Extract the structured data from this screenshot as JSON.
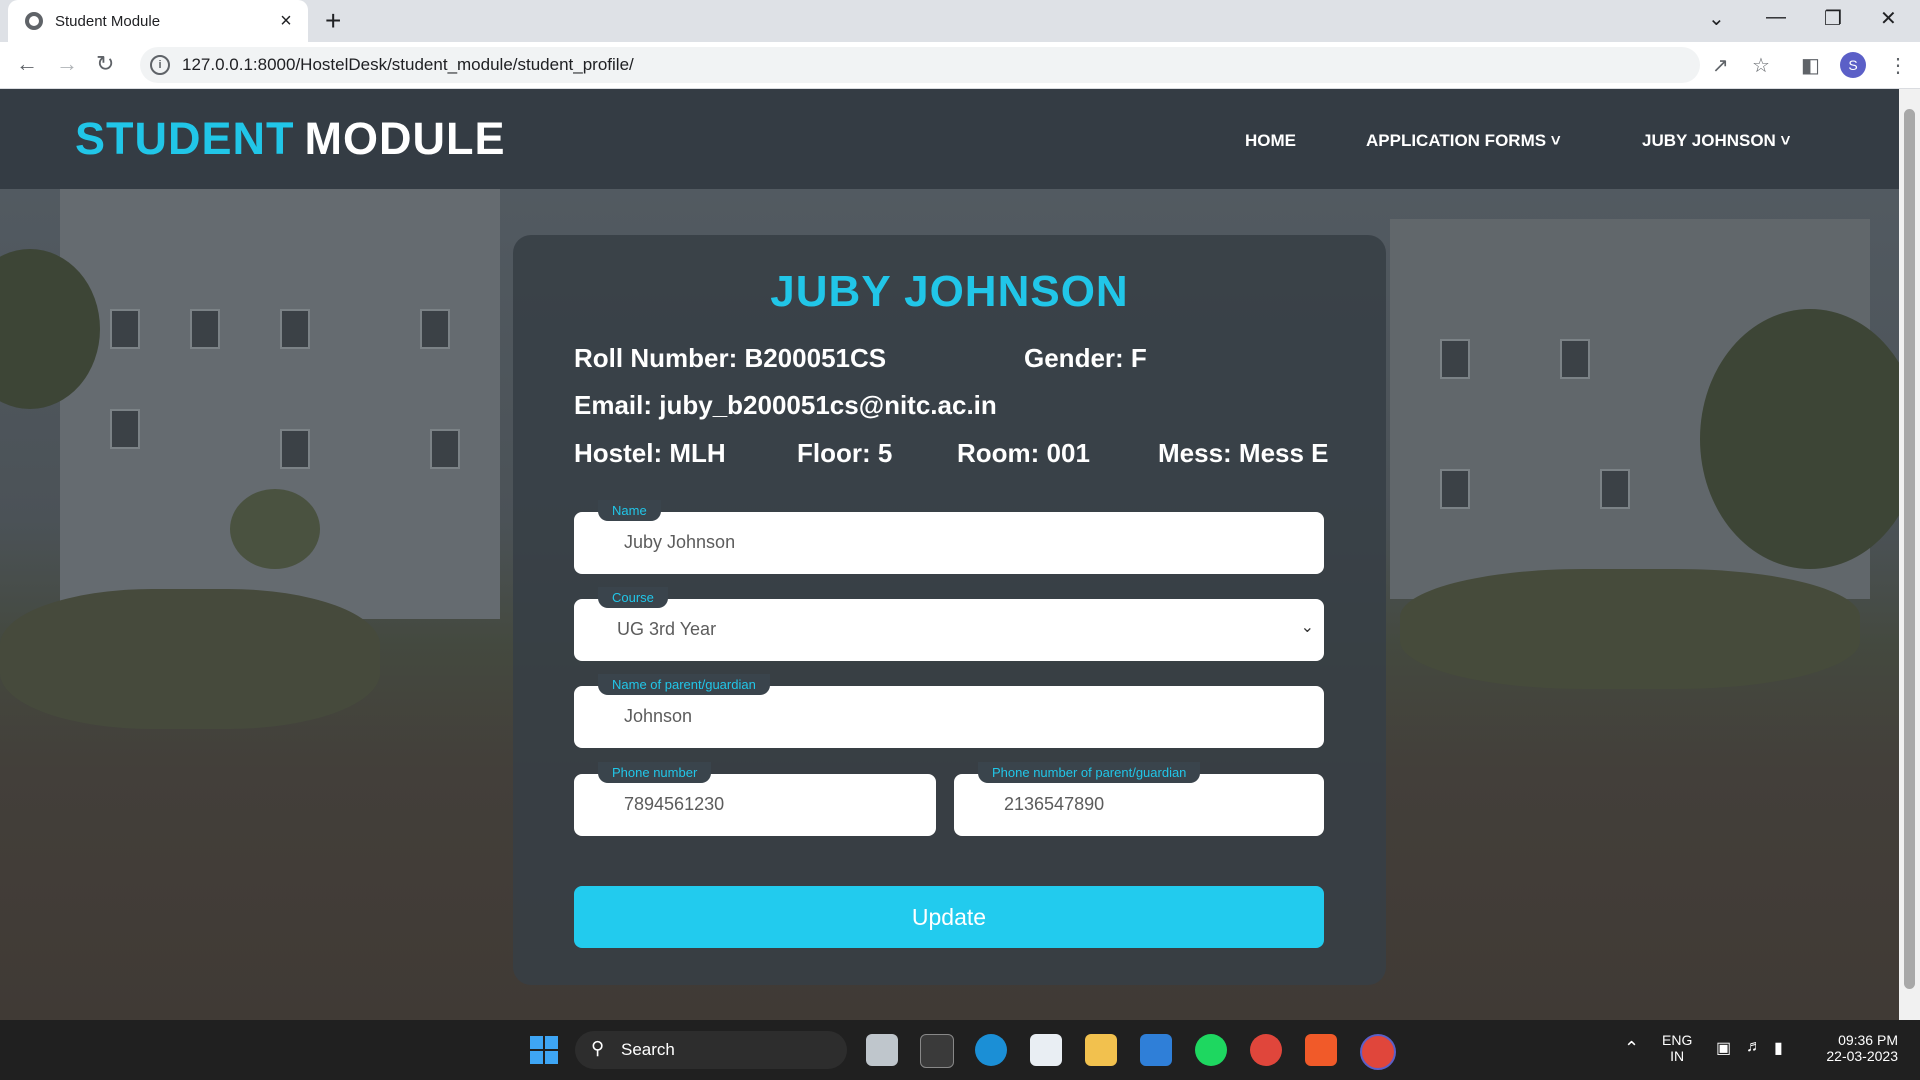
{
  "browser": {
    "tab_title": "Student Module",
    "url": "127.0.0.1:8000/HostelDesk/student_module/student_profile/",
    "profile_initial": "S"
  },
  "header": {
    "brand_part1": "STUDENT",
    "brand_part2": "MODULE",
    "nav": [
      "HOME",
      "APPLICATION FORMS ˅",
      "JUBY JOHNSON ˅"
    ]
  },
  "profile": {
    "name": "JUBY JOHNSON",
    "roll": "Roll Number: B200051CS",
    "gender": "Gender: F",
    "email": "Email: juby_b200051cs@nitc.ac.in",
    "hostel": "Hostel: MLH",
    "floor": "Floor: 5",
    "room": "Room: 001",
    "mess": "Mess: Mess E"
  },
  "form": {
    "name_label": "Name",
    "name_value": "Juby Johnson",
    "course_label": "Course",
    "course_value": "UG 3rd Year",
    "parent_label": "Name of parent/guardian",
    "parent_value": "Johnson",
    "phone_label": "Phone number",
    "phone_value": "7894561230",
    "parent_phone_label": "Phone number of parent/guardian",
    "parent_phone_value": "2136547890",
    "submit": "Update"
  },
  "taskbar": {
    "search": "Search",
    "lang1": "ENG",
    "lang2": "IN",
    "time": "09:36 PM",
    "date": "22-03-2023"
  },
  "colors": {
    "accent": "#21c6e8",
    "header_bg": "#343c44",
    "button": "#22cbee"
  }
}
